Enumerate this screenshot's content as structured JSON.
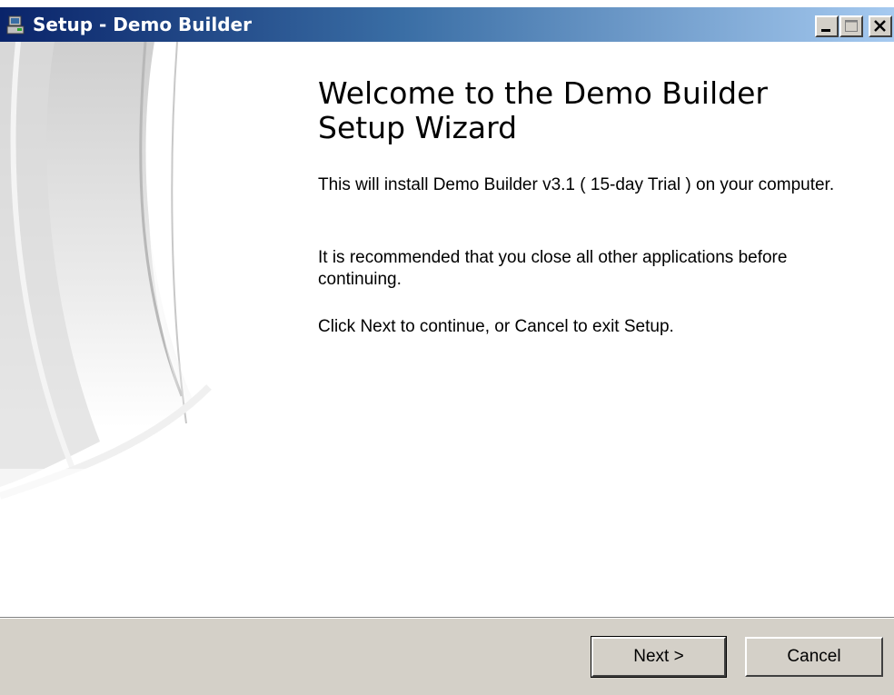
{
  "window": {
    "title": "Setup - Demo Builder",
    "title_gradient_start": "#0a246a",
    "title_gradient_end": "#a6caf0",
    "face_color": "#d4d0c8"
  },
  "titlebar_icons": {
    "app_icon": "setup-installer-icon",
    "minimize": "minimize-icon",
    "maximize": "maximize-icon",
    "close": "close-icon"
  },
  "main": {
    "heading": "Welcome to the Demo Builder Setup Wizard",
    "paragraphs": [
      "This will install Demo Builder v3.1 ( 15-day Trial ) on your computer.",
      "It is recommended that you close all other applications before continuing.",
      "Click Next to continue, or Cancel to exit Setup."
    ]
  },
  "footer": {
    "next_label": "Next >",
    "cancel_label": "Cancel"
  }
}
